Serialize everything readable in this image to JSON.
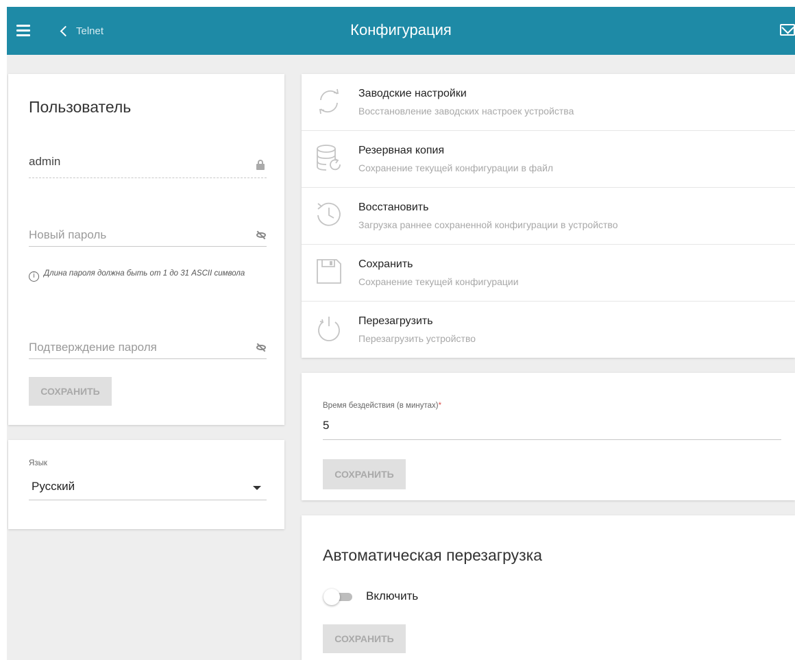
{
  "header": {
    "back_label": "Telnet",
    "title": "Конфигурация"
  },
  "user": {
    "title": "Пользователь",
    "username": "admin",
    "new_password_placeholder": "Новый пароль",
    "hint": "Длина пароля должна быть от 1 до 31 ASCII символа",
    "confirm_password_placeholder": "Подтверждение пароля",
    "save_label": "СОХРАНИТЬ"
  },
  "language": {
    "label": "Язык",
    "value": "Русский"
  },
  "actions": [
    {
      "title": "Заводские настройки",
      "desc": "Восстановление заводских настроек устройства",
      "icon": "factory-reset-icon"
    },
    {
      "title": "Резервная копия",
      "desc": "Сохранение текущей конфигурации в файл",
      "icon": "backup-database-icon"
    },
    {
      "title": "Восстановить",
      "desc": "Загрузка раннее сохраненной конфигурации в устройство",
      "icon": "restore-history-icon"
    },
    {
      "title": "Сохранить",
      "desc": "Сохранение текущей конфигурации",
      "icon": "floppy-save-icon"
    },
    {
      "title": "Перезагрузить",
      "desc": "Перезагрузить устройство",
      "icon": "power-reboot-icon"
    }
  ],
  "timeout": {
    "label": "Время бездействия (в минутах)",
    "required_mark": "*",
    "value": "5",
    "save_label": "СОХРАНИТЬ"
  },
  "auto_reboot": {
    "title": "Автоматическая перезагрузка",
    "toggle_label": "Включить",
    "enabled": false,
    "save_label": "СОХРАНИТЬ"
  },
  "colors": {
    "header": "#1e8aa6",
    "background": "#eeeeee",
    "disabled_button": "#e0e0e0",
    "required": "#d9534f"
  }
}
